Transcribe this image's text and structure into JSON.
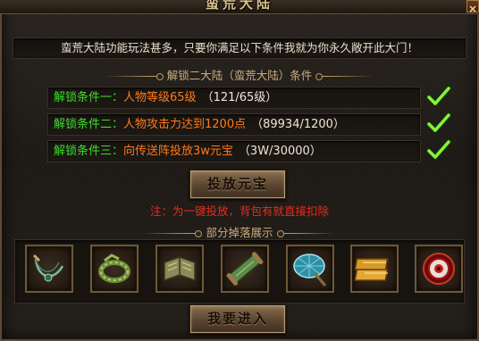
{
  "window": {
    "title": "蛮荒大陆",
    "close_icon": "close-icon"
  },
  "intro": "蛮荒大陆功能玩法甚多，只要你满足以下条件我就为你永久敞开此大门！",
  "unlock": {
    "header": "解锁二大陆（蛮荒大陆）条件",
    "conditions": [
      {
        "label": "解锁条件一：",
        "requirement": "人物等级65级",
        "progress": "（121/65级）",
        "met": true
      },
      {
        "label": "解锁条件二：",
        "requirement": "人物攻击力达到1200点",
        "progress": "（89934/1200）",
        "met": true
      },
      {
        "label": "解锁条件三：",
        "requirement": "向传送阵投放3w元宝",
        "progress": "（3W/30000）",
        "met": true
      }
    ]
  },
  "invest_button": "投放元宝",
  "note": "注：为一键投放，背包有就直接扣除",
  "drops": {
    "header": "部分掉落展示",
    "items": [
      {
        "icon": "necklace-icon"
      },
      {
        "icon": "bracelet-icon"
      },
      {
        "icon": "book-icon"
      },
      {
        "icon": "scroll-icon"
      },
      {
        "icon": "umbrella-icon"
      },
      {
        "icon": "gold-ingot-icon"
      },
      {
        "icon": "red-eye-orb-icon"
      }
    ]
  },
  "enter_button": "我要进入",
  "colors": {
    "label_green": "#3fdc2e",
    "requirement_orange": "#ff7a1c",
    "note_red": "#ea2a1c",
    "gold_text": "#c7ad7c"
  }
}
